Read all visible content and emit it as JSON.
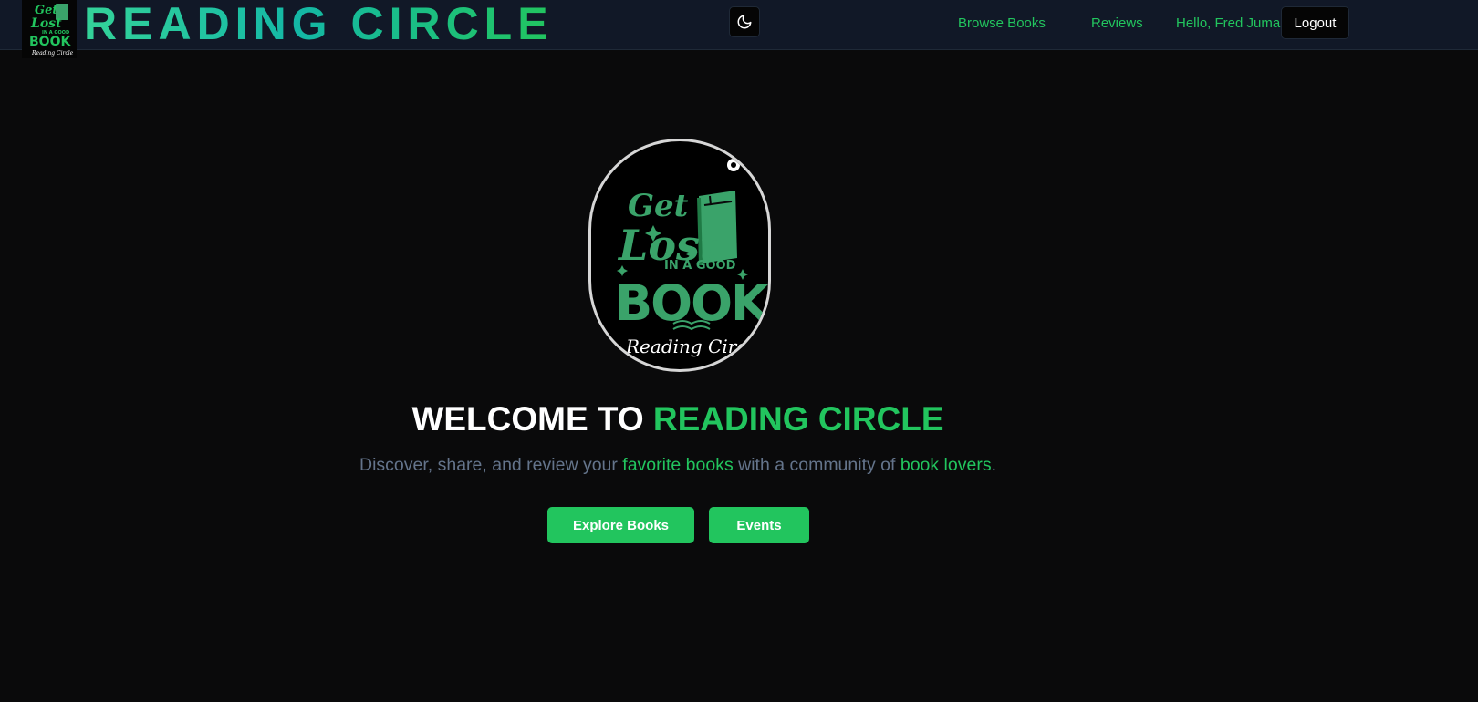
{
  "app": {
    "brand": "READING CIRCLE",
    "logo_text": [
      "Get",
      "Lost",
      "IN A GOOD",
      "BOOK",
      "Reading Circle"
    ]
  },
  "nav": {
    "theme_icon": "moon-icon",
    "links": [
      {
        "label": "Browse Books"
      },
      {
        "label": "Reviews"
      }
    ],
    "greeting": "Hello, Fred Juma",
    "logout_label": "Logout"
  },
  "hero": {
    "title_part1": "WELCOME TO ",
    "title_part2": "READING CIRCLE",
    "subtitle": {
      "t1": "Discover, share, and review your ",
      "h1": "favorite books",
      "t2": " with a community of ",
      "h2": "book lovers",
      "t3": "."
    },
    "buttons": {
      "explore": "Explore Books",
      "events": "Events"
    }
  },
  "colors": {
    "accent": "#22c55e",
    "nav_bg": "#111827",
    "page_bg": "#0a0a0b",
    "muted_text": "#64748b"
  }
}
